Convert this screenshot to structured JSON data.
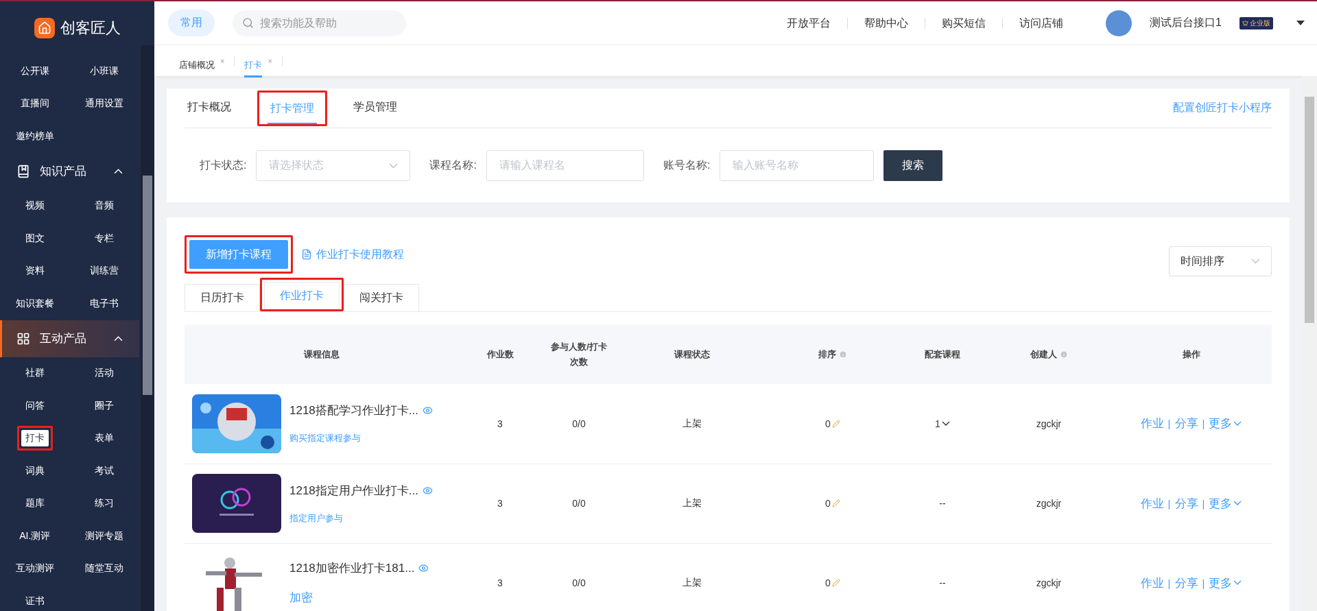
{
  "brand": {
    "name": "创客匠人"
  },
  "sidebar": {
    "top_items": [
      {
        "label": "公开课",
        "selected": false
      },
      {
        "label": "小班课",
        "selected": false
      },
      {
        "label": "直播间",
        "selected": false
      },
      {
        "label": "通用设置",
        "selected": false
      },
      {
        "label": "邀约榜单",
        "selected": false
      }
    ],
    "groups": [
      {
        "title": "知识产品",
        "kind": "book",
        "expanded": true,
        "active": false,
        "items": [
          {
            "label": "视频",
            "selected": false
          },
          {
            "label": "音频",
            "selected": false
          },
          {
            "label": "图文",
            "selected": false
          },
          {
            "label": "专栏",
            "selected": false
          },
          {
            "label": "资料",
            "selected": false
          },
          {
            "label": "训练营",
            "selected": false
          },
          {
            "label": "知识套餐",
            "selected": false
          },
          {
            "label": "电子书",
            "selected": false
          }
        ]
      },
      {
        "title": "互动产品",
        "kind": "grid",
        "expanded": true,
        "active": true,
        "items": [
          {
            "label": "社群",
            "selected": false
          },
          {
            "label": "活动",
            "selected": false
          },
          {
            "label": "问答",
            "selected": false
          },
          {
            "label": "圈子",
            "selected": false
          },
          {
            "label": "打卡",
            "selected": true,
            "highlighted": true
          },
          {
            "label": "表单",
            "selected": false
          },
          {
            "label": "词典",
            "selected": false
          },
          {
            "label": "考试",
            "selected": false
          },
          {
            "label": "题库",
            "selected": false
          },
          {
            "label": "练习",
            "selected": false
          },
          {
            "label": "AI.测评",
            "selected": false
          },
          {
            "label": "测评专题",
            "selected": false
          },
          {
            "label": "互动测评",
            "selected": false
          },
          {
            "label": "随堂互动",
            "selected": false
          },
          {
            "label": "证书",
            "selected": false
          }
        ]
      }
    ]
  },
  "topbar": {
    "quick": "常用",
    "search": {
      "placeholder": "搜索功能及帮助"
    },
    "links": [
      "开放平台",
      "帮助中心",
      "购买短信",
      "访问店铺"
    ],
    "user": {
      "name": "测试后台接口1",
      "badge": "企业版"
    }
  },
  "page_tabs": [
    {
      "label": "店铺概况",
      "selected": false,
      "close": "×"
    },
    {
      "label": "打卡",
      "selected": true,
      "close": "×"
    }
  ],
  "filter_card": {
    "tabs": [
      {
        "label": "打卡概况",
        "selected": false
      },
      {
        "label": "打卡管理",
        "selected": true,
        "highlighted": true
      },
      {
        "label": "学员管理",
        "selected": false
      }
    ],
    "config_link": "配置创匠打卡小程序",
    "filters": [
      {
        "label": "打卡状态:",
        "kind": "select",
        "placeholder": "请选择状态"
      },
      {
        "label": "课程名称:",
        "kind": "input",
        "placeholder": "请输入课程名"
      },
      {
        "label": "账号名称:",
        "kind": "input",
        "placeholder": "输入账号名称"
      }
    ],
    "search_button": "搜索"
  },
  "list_card": {
    "create_button": {
      "label": "新增打卡课程",
      "highlighted": true
    },
    "tutorial_link": "作业打卡使用教程",
    "sort_select": "时间排序",
    "type_tabs": [
      {
        "label": "日历打卡",
        "selected": false
      },
      {
        "label": "作业打卡",
        "selected": true,
        "highlighted": true
      },
      {
        "label": "闯关打卡",
        "selected": false
      }
    ],
    "table": {
      "columns": [
        {
          "label": "课程信息",
          "info": false
        },
        {
          "label": "作业数",
          "info": false
        },
        {
          "label": "参与人数/打卡次数",
          "info": false
        },
        {
          "label": "课程状态",
          "info": false
        },
        {
          "label": "排序",
          "info": true
        },
        {
          "label": "配套课程",
          "info": false
        },
        {
          "label": "创建人",
          "info": true
        },
        {
          "label": "操作",
          "info": false
        }
      ],
      "rows": [
        {
          "kind": "condition",
          "title": "1218搭配学习作业打卡...",
          "subtitle": "购买指定课程参与",
          "tasks": "3",
          "participation": "0/0",
          "status": "上架",
          "sort": "0",
          "bundle": "1",
          "bundle_dropdown": true,
          "creator": "zgckjr",
          "actions": [
            "作业",
            "|",
            "分享",
            "|",
            "更多"
          ]
        },
        {
          "kind": "condition",
          "title": "1218指定用户作业打卡...",
          "subtitle": "指定用户参与",
          "tasks": "3",
          "participation": "0/0",
          "status": "上架",
          "sort": "0",
          "bundle": "--",
          "bundle_dropdown": false,
          "creator": "zgckjr",
          "actions": [
            "作业",
            "|",
            "分享",
            "|",
            "更多"
          ]
        },
        {
          "kind": "password",
          "title": "1218加密作业打卡181...",
          "subtitle": "加密",
          "tasks": "3",
          "participation": "0/0",
          "status": "上架",
          "sort": "0",
          "bundle": "--",
          "bundle_dropdown": false,
          "creator": "zgckjr",
          "actions": [
            "作业",
            "|",
            "分享",
            "|",
            "更多"
          ]
        }
      ]
    }
  }
}
